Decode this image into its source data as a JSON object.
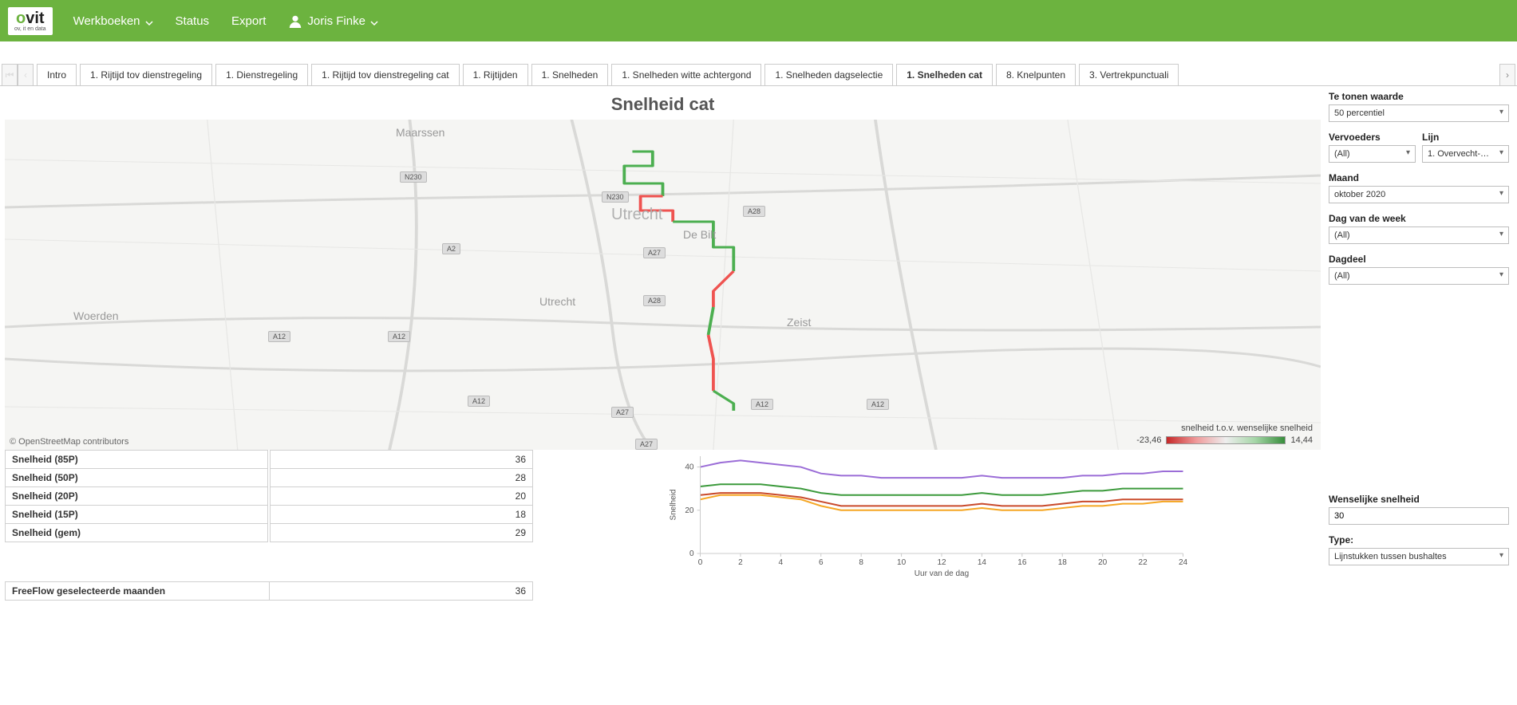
{
  "nav": {
    "logo_main": "ovit",
    "logo_sub": "ov, it en data",
    "werkboeken": "Werkboeken",
    "status": "Status",
    "export": "Export",
    "user": "Joris Finke"
  },
  "tabs": [
    "Intro",
    "1. Rijtijd tov dienstregeling",
    "1. Dienstregeling",
    "1. Rijtijd tov dienstregeling cat",
    "1. Rijtijden",
    "1. Snelheden",
    "1. Snelheden witte achtergond",
    "1. Snelheden dagselectie",
    "1. Snelheden cat",
    "8. Knelpunten",
    "3. Vertrekpunctuali"
  ],
  "active_tab_index": 8,
  "page_title": "Snelheid cat",
  "map": {
    "attr": "© OpenStreetMap contributors",
    "legend_title": "snelheid t.o.v. wenselijke snelheid",
    "legend_min": "-23,46",
    "legend_max": "14,44",
    "city_labels": [
      "Maarssen",
      "Utrecht",
      "De Bilt",
      "Zeist",
      "Woerden",
      "Utrecht"
    ],
    "roads": [
      "N230",
      "N230",
      "A27",
      "A28",
      "A28",
      "A2",
      "A12",
      "A12",
      "A12",
      "A12",
      "A12",
      "A27",
      "A27"
    ]
  },
  "stats": [
    {
      "k": "Snelheid (85P)",
      "v": "36"
    },
    {
      "k": "Snelheid (50P)",
      "v": "28"
    },
    {
      "k": "Snelheid (20P)",
      "v": "20"
    },
    {
      "k": "Snelheid (15P)",
      "v": "18"
    },
    {
      "k": "Snelheid (gem)",
      "v": "29"
    }
  ],
  "freeflow": {
    "k": "FreeFlow geselecteerde maanden",
    "v": "36"
  },
  "chart": {
    "ylabel": "Snelheid",
    "xlabel": "Uur van de dag"
  },
  "chart_data": {
    "type": "line",
    "x": [
      0,
      1,
      2,
      3,
      4,
      5,
      6,
      7,
      8,
      9,
      10,
      11,
      12,
      13,
      14,
      15,
      16,
      17,
      18,
      19,
      20,
      21,
      22,
      23,
      24
    ],
    "series": [
      {
        "name": "85P",
        "color": "#9b6dd7",
        "values": [
          40,
          42,
          43,
          42,
          41,
          40,
          37,
          36,
          36,
          35,
          35,
          35,
          35,
          35,
          36,
          35,
          35,
          35,
          35,
          36,
          36,
          37,
          37,
          38,
          38
        ]
      },
      {
        "name": "gem",
        "color": "#3c9a3c",
        "values": [
          31,
          32,
          32,
          32,
          31,
          30,
          28,
          27,
          27,
          27,
          27,
          27,
          27,
          27,
          28,
          27,
          27,
          27,
          28,
          29,
          29,
          30,
          30,
          30,
          30
        ]
      },
      {
        "name": "50P",
        "color": "#c94a2b",
        "values": [
          27,
          28,
          28,
          28,
          27,
          26,
          24,
          22,
          22,
          22,
          22,
          22,
          22,
          22,
          23,
          22,
          22,
          22,
          23,
          24,
          24,
          25,
          25,
          25,
          25
        ]
      },
      {
        "name": "20P",
        "color": "#f5a623",
        "values": [
          25,
          27,
          27,
          27,
          26,
          25,
          22,
          20,
          20,
          20,
          20,
          20,
          20,
          20,
          21,
          20,
          20,
          20,
          21,
          22,
          22,
          23,
          23,
          24,
          24
        ]
      }
    ],
    "xlabel": "Uur van de dag",
    "ylabel": "Snelheid",
    "ylim": [
      0,
      45
    ],
    "xlim": [
      0,
      24
    ],
    "yticks": [
      0,
      20,
      40
    ],
    "xticks": [
      0,
      2,
      4,
      6,
      8,
      10,
      12,
      14,
      16,
      18,
      20,
      22,
      24
    ]
  },
  "filters": {
    "te_tonen_label": "Te tonen waarde",
    "te_tonen_value": "50 percentiel",
    "vervoeders_label": "Vervoeders",
    "vervoeders_value": "(All)",
    "lijn_label": "Lijn",
    "lijn_value": "1. Overvecht-…",
    "maand_label": "Maand",
    "maand_value": "oktober 2020",
    "dag_label": "Dag van de week",
    "dag_value": "(All)",
    "dagdeel_label": "Dagdeel",
    "dagdeel_value": "(All)",
    "wenselijke_label": "Wenselijke snelheid",
    "wenselijke_value": "30",
    "type_label": "Type:",
    "type_value": "Lijnstukken tussen bushaltes"
  }
}
